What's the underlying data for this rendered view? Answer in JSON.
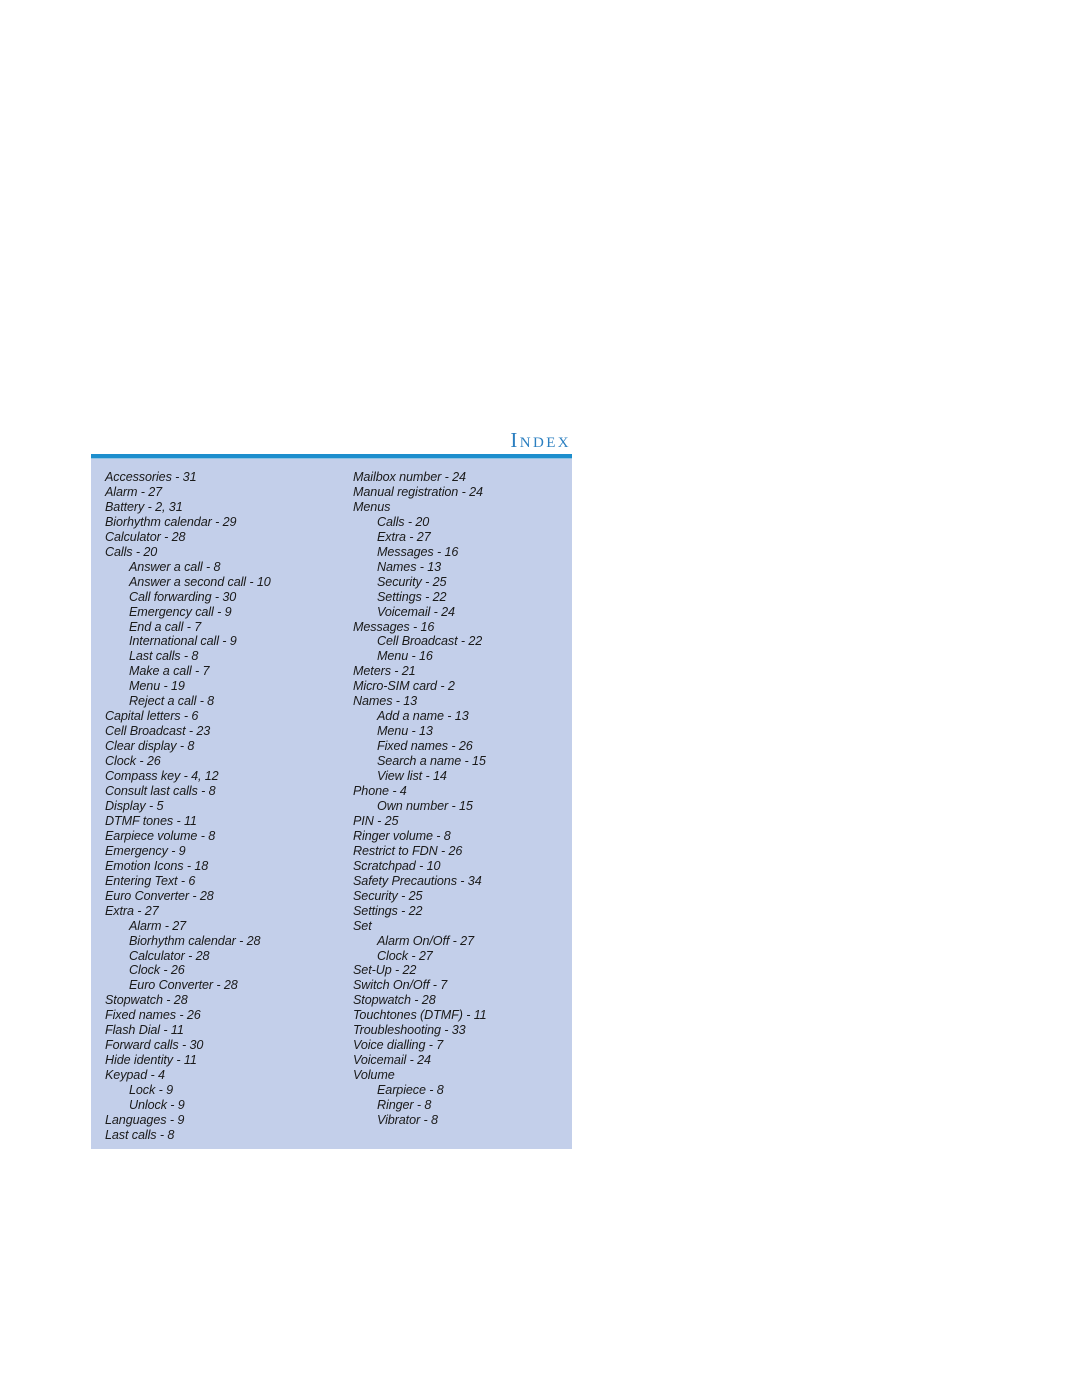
{
  "page": {
    "title": "Index",
    "background_color": "#ffffff",
    "panel_background_color": "#c3cfea",
    "rule_color": "#1d8ecd",
    "title_color": "#2b7fc0"
  },
  "index": {
    "heading": "Index",
    "columns": [
      {
        "name": "left-column",
        "entries": [
          {
            "label": "Accessories - 31",
            "level": 1
          },
          {
            "label": "Alarm - 27",
            "level": 1
          },
          {
            "label": "Battery - 2, 31",
            "level": 1
          },
          {
            "label": "Biorhythm calendar - 29",
            "level": 1
          },
          {
            "label": "Calculator - 28",
            "level": 1
          },
          {
            "label": "Calls - 20",
            "level": 1
          },
          {
            "label": "Answer a call - 8",
            "level": 2
          },
          {
            "label": "Answer a second call - 10",
            "level": 2
          },
          {
            "label": "Call forwarding - 30",
            "level": 2
          },
          {
            "label": "Emergency call - 9",
            "level": 2
          },
          {
            "label": "End a call - 7",
            "level": 2
          },
          {
            "label": "International call - 9",
            "level": 2
          },
          {
            "label": "Last calls - 8",
            "level": 2
          },
          {
            "label": "Make a call - 7",
            "level": 2
          },
          {
            "label": "Menu - 19",
            "level": 2
          },
          {
            "label": "Reject a call - 8",
            "level": 2
          },
          {
            "label": "Capital letters - 6",
            "level": 1
          },
          {
            "label": "Cell Broadcast - 23",
            "level": 1
          },
          {
            "label": "Clear display - 8",
            "level": 1
          },
          {
            "label": "Clock - 26",
            "level": 1
          },
          {
            "label": "Compass key - 4, 12",
            "level": 1
          },
          {
            "label": "Consult last calls - 8",
            "level": 1
          },
          {
            "label": "Display - 5",
            "level": 1
          },
          {
            "label": "DTMF tones - 11",
            "level": 1
          },
          {
            "label": "Earpiece volume - 8",
            "level": 1
          },
          {
            "label": "Emergency - 9",
            "level": 1
          },
          {
            "label": "Emotion Icons - 18",
            "level": 1
          },
          {
            "label": "Entering Text - 6",
            "level": 1
          },
          {
            "label": "Euro Converter - 28",
            "level": 1
          },
          {
            "label": "Extra - 27",
            "level": 1
          },
          {
            "label": "Alarm - 27",
            "level": 2
          },
          {
            "label": "Biorhythm calendar - 28",
            "level": 2
          },
          {
            "label": "Calculator - 28",
            "level": 2
          },
          {
            "label": "Clock - 26",
            "level": 2
          },
          {
            "label": "Euro Converter - 28",
            "level": 2
          },
          {
            "label": "Stopwatch - 28",
            "level": 1
          },
          {
            "label": "Fixed names - 26",
            "level": 1
          },
          {
            "label": "Flash Dial - 11",
            "level": 1
          },
          {
            "label": "Forward calls - 30",
            "level": 1
          },
          {
            "label": "Hide identity - 11",
            "level": 1
          },
          {
            "label": "Keypad - 4",
            "level": 1
          },
          {
            "label": "Lock - 9",
            "level": 2
          },
          {
            "label": "Unlock - 9",
            "level": 2
          },
          {
            "label": "Languages - 9",
            "level": 1
          },
          {
            "label": "Last calls - 8",
            "level": 1
          }
        ]
      },
      {
        "name": "right-column",
        "entries": [
          {
            "label": "Mailbox number - 24",
            "level": 1
          },
          {
            "label": "Manual registration - 24",
            "level": 1
          },
          {
            "label": "Menus",
            "level": 1
          },
          {
            "label": "Calls - 20",
            "level": 2
          },
          {
            "label": "Extra - 27",
            "level": 2
          },
          {
            "label": "Messages - 16",
            "level": 2
          },
          {
            "label": "Names - 13",
            "level": 2
          },
          {
            "label": "Security - 25",
            "level": 2
          },
          {
            "label": "Settings - 22",
            "level": 2
          },
          {
            "label": "Voicemail - 24",
            "level": 2
          },
          {
            "label": "Messages - 16",
            "level": 1
          },
          {
            "label": "Cell Broadcast - 22",
            "level": 2
          },
          {
            "label": "Menu - 16",
            "level": 2
          },
          {
            "label": "Meters - 21",
            "level": 1
          },
          {
            "label": "Micro-SIM card - 2",
            "level": 1
          },
          {
            "label": "Names - 13",
            "level": 1
          },
          {
            "label": "Add a name - 13",
            "level": 2
          },
          {
            "label": "Menu - 13",
            "level": 2
          },
          {
            "label": "Fixed names - 26",
            "level": 2
          },
          {
            "label": "Search a name - 15",
            "level": 2
          },
          {
            "label": "View list - 14",
            "level": 2
          },
          {
            "label": "Phone - 4",
            "level": 1
          },
          {
            "label": "Own number - 15",
            "level": 2
          },
          {
            "label": "PIN - 25",
            "level": 1
          },
          {
            "label": "Ringer volume - 8",
            "level": 1
          },
          {
            "label": "Restrict to FDN - 26",
            "level": 1
          },
          {
            "label": "Scratchpad - 10",
            "level": 1
          },
          {
            "label": "Safety Precautions - 34",
            "level": 1
          },
          {
            "label": "Security - 25",
            "level": 1
          },
          {
            "label": "Settings - 22",
            "level": 1
          },
          {
            "label": "Set",
            "level": 1
          },
          {
            "label": "Alarm On/Off - 27",
            "level": 2
          },
          {
            "label": "Clock - 27",
            "level": 2
          },
          {
            "label": "Set-Up - 22",
            "level": 1
          },
          {
            "label": "Switch On/Off - 7",
            "level": 1
          },
          {
            "label": "Stopwatch - 28",
            "level": 1
          },
          {
            "label": "Touchtones (DTMF) - 11",
            "level": 1
          },
          {
            "label": "Troubleshooting - 33",
            "level": 1
          },
          {
            "label": "Voice dialling - 7",
            "level": 1
          },
          {
            "label": "Voicemail - 24",
            "level": 1
          },
          {
            "label": "Volume",
            "level": 1
          },
          {
            "label": "Earpiece - 8",
            "level": 2
          },
          {
            "label": "Ringer - 8",
            "level": 2
          },
          {
            "label": "Vibrator - 8",
            "level": 2
          }
        ]
      }
    ]
  }
}
